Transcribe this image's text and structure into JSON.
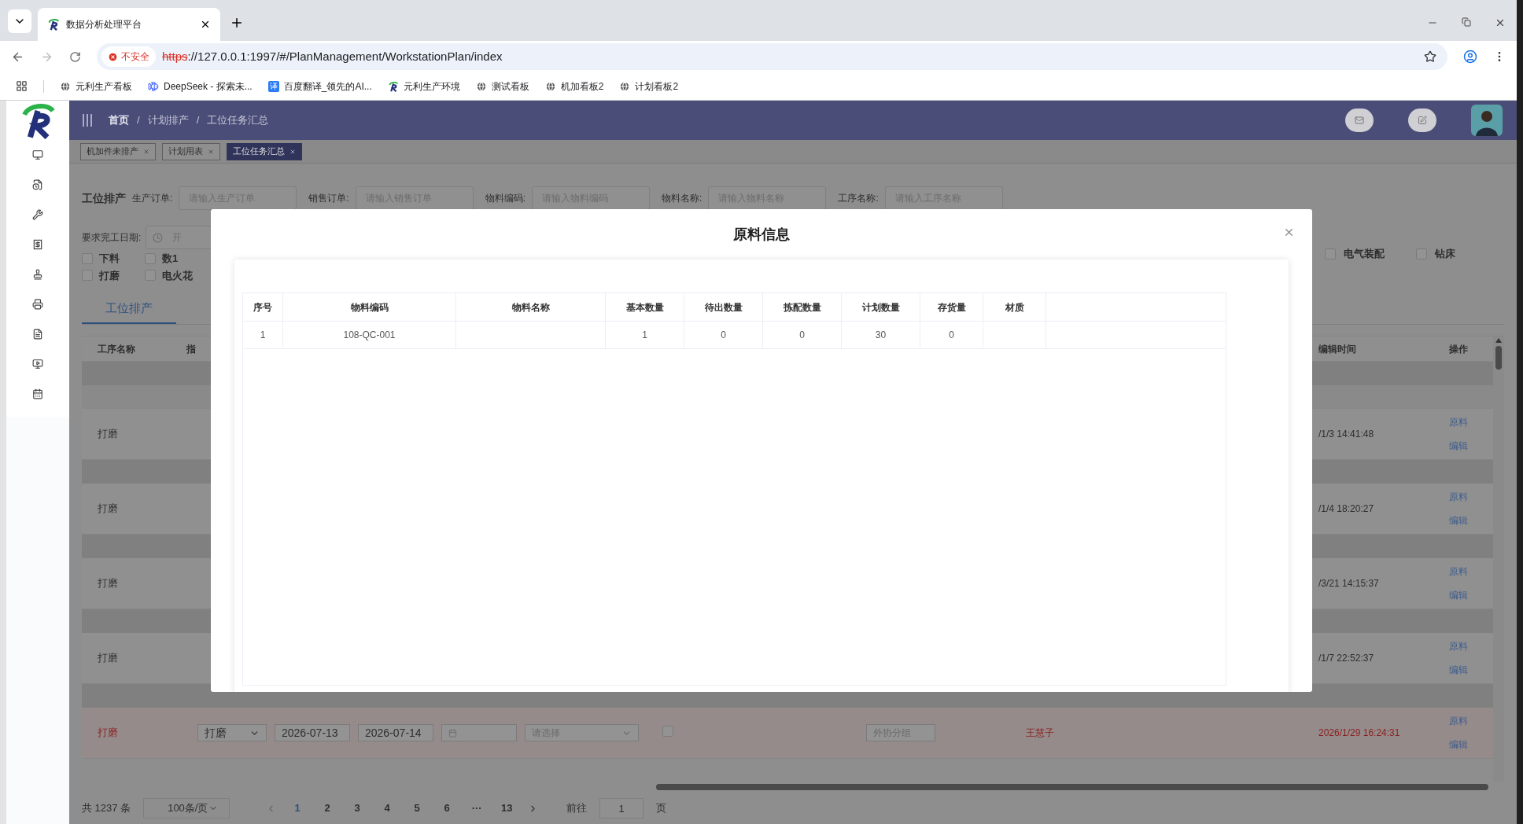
{
  "browser": {
    "tab_title": "数据分析处理平台",
    "security": "不安全",
    "url_scheme": "https",
    "url_rest": "://127.0.0.1:1997/#/PlanManagement/WorkstationPlan/index",
    "bookmarks": [
      {
        "kind": "globe",
        "label": "元利生产看板"
      },
      {
        "kind": "whale",
        "label": "DeepSeek - 探索未..."
      },
      {
        "kind": "translate",
        "icon_text": "译",
        "label": "百度翻译_领先的AI..."
      },
      {
        "kind": "logo",
        "label": "元利生产环境"
      },
      {
        "kind": "globe",
        "label": "测试看板"
      },
      {
        "kind": "globe",
        "label": "机加看板2"
      },
      {
        "kind": "globe",
        "label": "计划看板2"
      }
    ]
  },
  "header": {
    "breadcrumb": [
      "首页",
      "计划排产",
      "工位任务汇总"
    ],
    "separator": "/"
  },
  "tags": [
    {
      "label": "机加件未排产",
      "selected": false
    },
    {
      "label": "计划用表",
      "selected": false
    },
    {
      "label": "工位任务汇总",
      "selected": true
    }
  ],
  "filters": {
    "title": "工位排产",
    "fields": [
      {
        "label": "生产订单:",
        "placeholder": "请输入生产订单"
      },
      {
        "label": "销售订单:",
        "placeholder": "请输入销售订单"
      },
      {
        "label": "物料编码:",
        "placeholder": "请输入物料编码"
      },
      {
        "label": "物料名称:",
        "placeholder": "请输入物料名称"
      },
      {
        "label": "工序名称:",
        "placeholder": "请输入工序名称"
      }
    ],
    "date_label": "要求完工日期:",
    "date_placeholder": "开"
  },
  "checkboxes_left": [
    {
      "label": "下料",
      "checked": false
    },
    {
      "label": "数1",
      "checked": false
    },
    {
      "label": "打磨",
      "checked": false
    },
    {
      "label": "电火花",
      "checked": false
    }
  ],
  "checkboxes_right": [
    {
      "label": "电气装配",
      "checked": false
    },
    {
      "label": "钻床",
      "checked": false
    }
  ],
  "tabs": [
    {
      "label": "工位排产",
      "selected": true
    }
  ],
  "table": {
    "columns_left": [
      "工序名称",
      "指"
    ],
    "columns_right": [
      "编辑时间",
      "操作"
    ],
    "rows": [
      {
        "kind": "plain",
        "warning": false,
        "process": "打磨",
        "edit_time": "/1/3 14:41:48",
        "actions": [
          "原料",
          "编辑"
        ]
      },
      {
        "kind": "plain",
        "warning": false,
        "process": "打磨",
        "edit_time": "/1/4 18:20:27",
        "actions": [
          "原料",
          "编辑"
        ]
      },
      {
        "kind": "plain",
        "warning": false,
        "process": "打磨",
        "edit_time": "/3/21 14:15:37",
        "actions": [
          "原料",
          "编辑"
        ]
      },
      {
        "kind": "plain",
        "warning": false,
        "process": "打磨",
        "edit_time": "/1/7 22:52:37",
        "actions": [
          "原料",
          "编辑"
        ]
      },
      {
        "kind": "editable",
        "warning": true,
        "process": "打磨",
        "select": "打磨",
        "start": "2026-07-13",
        "end": "2026-07-14",
        "select2_placeholder": "请选择",
        "checked": false,
        "group_placeholder": "外协分组",
        "person": "王慧子",
        "edit_time": "2026/1/29 16:24:31",
        "actions": [
          "原料",
          "编辑"
        ]
      }
    ]
  },
  "pagination": {
    "total": "共 1237 条",
    "page_size": "100条/页",
    "pages": [
      {
        "label": "1",
        "selected": true
      },
      {
        "label": "2",
        "selected": false
      },
      {
        "label": "3",
        "selected": false
      },
      {
        "label": "4",
        "selected": false
      },
      {
        "label": "5",
        "selected": false
      },
      {
        "label": "6",
        "selected": false
      },
      {
        "label": "···",
        "selected": false
      },
      {
        "label": "13",
        "selected": false
      }
    ],
    "goto_label": "前往",
    "goto_value": "1",
    "page_suffix": "页"
  },
  "dialog": {
    "title": "原料信息",
    "columns": [
      "序号",
      "物料编码",
      "物料名称",
      "基本数量",
      "待出数量",
      "拣配数量",
      "计划数量",
      "存货量",
      "材质"
    ],
    "rows": [
      {
        "index": "1",
        "code": "108-QC-001",
        "basic_qty": "1",
        "pending_qty": "0",
        "picked_qty": "0",
        "planned_qty": "30",
        "stock_qty": "0"
      }
    ]
  }
}
